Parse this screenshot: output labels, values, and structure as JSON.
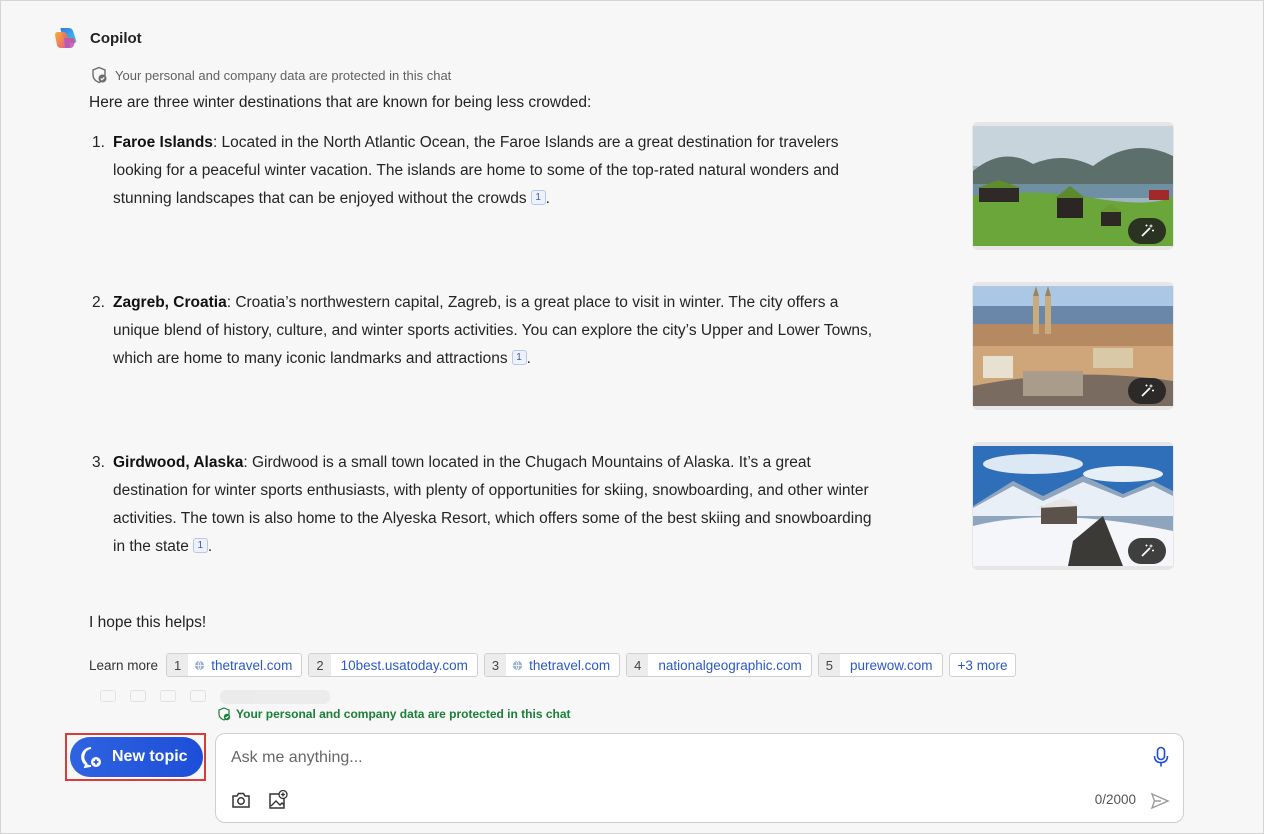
{
  "header": {
    "app_name": "Copilot",
    "privacy_note": "Your personal and company data are protected in this chat"
  },
  "response": {
    "intro": "Here are three winter destinations that are known for being less crowded:",
    "items": [
      {
        "number": "1.",
        "title": "Faroe Islands",
        "text": ": Located in the North Atlantic Ocean, the Faroe Islands are a great destination for travelers looking for a peaceful winter vacation. The islands are home to some of the top-rated natural wonders and stunning landscapes that can be enjoyed without the crowds",
        "citation": "1",
        "end": "."
      },
      {
        "number": "2.",
        "title": "Zagreb, Croatia",
        "text": ": Croatia’s northwestern capital, Zagreb, is a great place to visit in winter. The city offers a unique blend of history, culture, and winter sports activities. You can explore the city’s Upper and Lower Towns, which are home to many iconic landmarks and attractions",
        "citation": "1",
        "end": "."
      },
      {
        "number": "3.",
        "title": "Girdwood, Alaska",
        "text": ": Girdwood is a small town located in the Chugach Mountains of Alaska. It’s a great destination for winter sports enthusiasts, with plenty of opportunities for skiing, snowboarding, and other winter activities. The town is also home to the Alyeska Resort, which offers some of the best skiing and snowboarding in the state",
        "citation": "1",
        "end": "."
      }
    ],
    "closing": "I hope this helps!"
  },
  "learn_more": {
    "label": "Learn more",
    "sources": [
      {
        "n": "1",
        "domain": "thetravel.com",
        "globe": true
      },
      {
        "n": "2",
        "domain": "10best.usatoday.com",
        "globe": false
      },
      {
        "n": "3",
        "domain": "thetravel.com",
        "globe": true
      },
      {
        "n": "4",
        "domain": "nationalgeographic.com",
        "globe": false
      },
      {
        "n": "5",
        "domain": "purewow.com",
        "globe": false
      }
    ],
    "more": "+3 more"
  },
  "footer": {
    "privacy_note": "Your personal and company data are protected in this chat",
    "new_topic_label": "New topic",
    "input_placeholder": "Ask me anything...",
    "char_count": "0/2000"
  },
  "colors": {
    "accent": "#1d4ed8",
    "link": "#2b59c3",
    "privacy_green": "#1a7f37",
    "highlight_border": "#d93a3a"
  },
  "icons": [
    "copilot-logo",
    "shield-check-icon",
    "magic-wand-icon",
    "globe-icon",
    "new-chat-icon",
    "microphone-icon",
    "camera-icon",
    "add-image-icon",
    "send-icon"
  ]
}
